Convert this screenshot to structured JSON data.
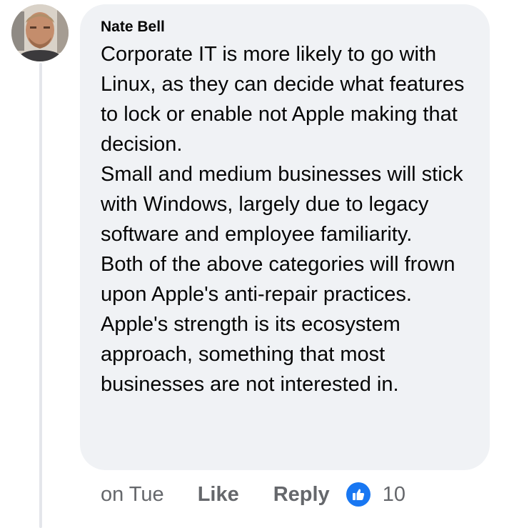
{
  "comment": {
    "author": "Nate Bell",
    "paragraphs": [
      "Corporate IT is more likely to go with Linux, as they can decide what features to lock or enable not Apple making that decision.",
      "Small and medium businesses will stick with Windows, largely due to legacy software and employee familiarity.",
      "Both of the above categories will frown upon Apple's anti-repair practices.",
      "Apple's strength is its ecosystem approach, something that most businesses are not interested in."
    ],
    "timestamp": "on Tue",
    "like_label": "Like",
    "reply_label": "Reply",
    "reaction_icon": "thumbs-up-icon",
    "reaction_count": "10"
  },
  "colors": {
    "bubble": "#f0f2f5",
    "thread_line": "#e4e6eb",
    "secondary_text": "#65676b",
    "like_blue": "#1877f2"
  }
}
